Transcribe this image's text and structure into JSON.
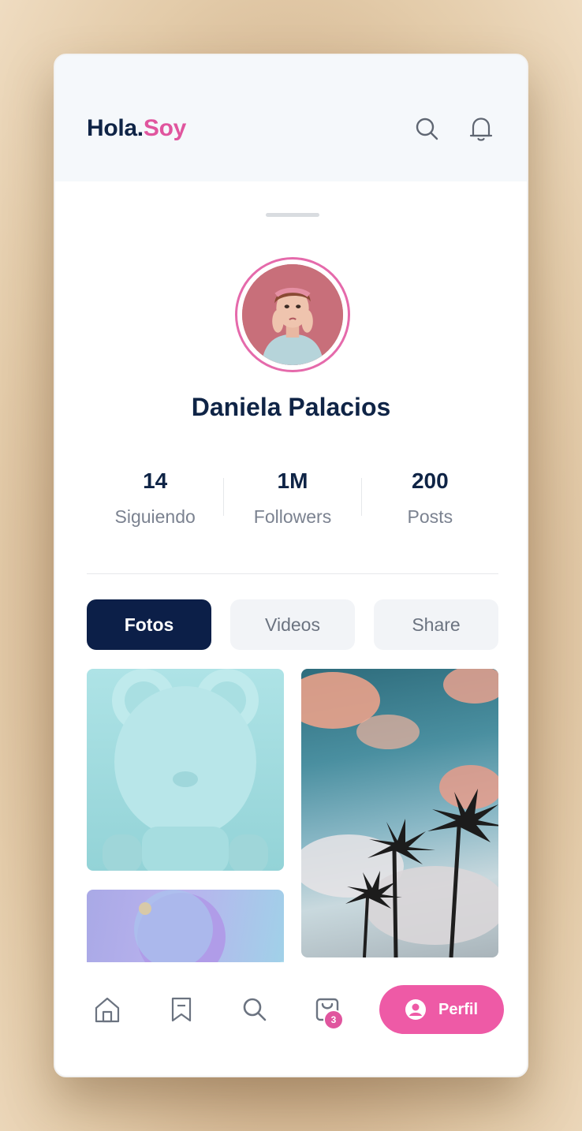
{
  "header": {
    "logo_main": "Hola.",
    "logo_accent": "Soy",
    "icons": [
      "search-icon",
      "bell-icon"
    ]
  },
  "profile": {
    "name": "Daniela Palacios"
  },
  "stats": [
    {
      "value": "14",
      "label": "Siguiendo"
    },
    {
      "value": "1M",
      "label": "Followers"
    },
    {
      "value": "200",
      "label": "Posts"
    }
  ],
  "tabs": [
    {
      "label": "Fotos",
      "active": true
    },
    {
      "label": "Videos",
      "active": false
    },
    {
      "label": "Share",
      "active": false
    }
  ],
  "bottom_nav": {
    "items": [
      "home-icon",
      "bookmark-icon",
      "search-icon",
      "bag-icon"
    ],
    "bag_badge": "3",
    "profile_label": "Perfil"
  },
  "colors": {
    "accent": "#e0559e",
    "navy": "#0f2446",
    "active_tab": "#0c1f48",
    "perfil_button": "#ee5aa6"
  }
}
